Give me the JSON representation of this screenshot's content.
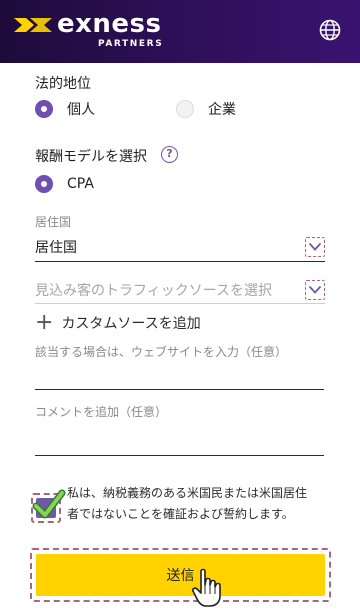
{
  "header": {
    "brand": "exness",
    "brand_sub": "PARTNERS",
    "colors": {
      "bg_from": "#1e0b3a",
      "bg_to": "#3a1370",
      "logo_accent": "#ffd200"
    },
    "globe_icon": "globe-icon"
  },
  "legal_status": {
    "label": "法的地位",
    "options": [
      {
        "label": "個人",
        "selected": true
      },
      {
        "label": "企業",
        "selected": false
      }
    ]
  },
  "reward_model": {
    "label": "報酬モデルを選択",
    "help_glyph": "?",
    "options": [
      {
        "label": "CPA",
        "selected": true
      }
    ]
  },
  "country": {
    "small_label": "居住国",
    "value": "居住国"
  },
  "traffic_source": {
    "placeholder": "見込み客のトラフィックソースを選択"
  },
  "custom_source": {
    "plus": "+",
    "label": "カスタムソースを追加"
  },
  "website": {
    "label": "該当する場合は、ウェブサイトを入力（任意）",
    "value": ""
  },
  "comment": {
    "label": "コメントを追加（任意）",
    "value": ""
  },
  "consent": {
    "checked": true,
    "text": "私は、納税義務のある米国民または米国居住者ではないことを確証および誓約します。"
  },
  "submit": {
    "label": "送信",
    "color": "#ffd200"
  },
  "accent_color": "#6f4fb0"
}
